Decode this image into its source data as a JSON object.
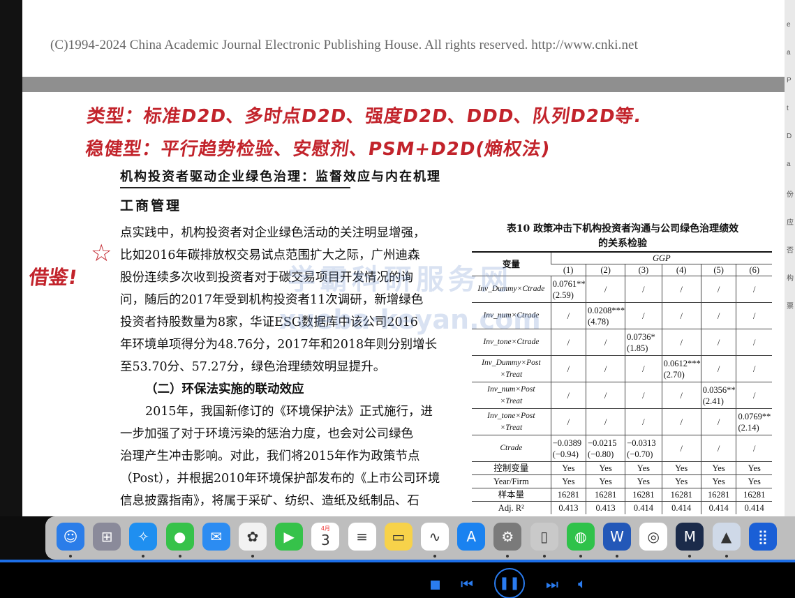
{
  "top_page": {
    "copyright": "(C)1994-2024 China Academic Journal Electronic Publishing House. All rights reserved.      http://www.cnki.net"
  },
  "handwriting": {
    "line1": "类型：标准D2D、多时点D2D、强度D2D、DDD、队列D2D等.",
    "line2": "稳健型：平行趋势检验、安慰剂、PSM+D2D(熵权法)",
    "note": "借鉴!",
    "star": "☆"
  },
  "paper": {
    "title": "机构投资者驱动企业绿色治理：监督效应与内在机理",
    "section": "工商管理",
    "lines": [
      "点实践中，机构投资者对企业绿色活动的关注明显增强，",
      "比如2016年碳排放权交易试点范围扩大之际，广州迪森",
      "股份连续多次收到投资者对于碳交易项目开发情况的询",
      "问，随后的2017年受到机构投资者11次调研，新增绿色",
      "投资者持股数量为8家，华证ESG数据库中该公司2016",
      "年环境单项得分为48.76分，2017年和2018年则分别增长",
      "至53.70分、57.27分，绿色治理绩效明显提升。"
    ],
    "subheading": "（二）环保法实施的联动效应",
    "lines2": [
      "2015年，我国新修订的《环境保护法》正式施行，进",
      "一步加强了对于环境污染的惩治力度，也会对公司绿色",
      "治理产生冲击影响。对此，我们将2015年作为政策节点",
      "（Post），并根据2010年环境保护部发布的《上市公司环境",
      "信息披露指南》，将属于采矿、纺织、造纸及纸制品、石"
    ]
  },
  "table": {
    "title_line1": "表10  政策冲击下机构投资者沟通与公司绿色治理绩效",
    "title_line2": "的关系检验",
    "var_header": "变量",
    "dep_header": "GGP",
    "cols": [
      "(1)",
      "(2)",
      "(3)",
      "(4)",
      "(5)",
      "(6)"
    ],
    "rows": [
      {
        "var": "Inv_Dummy×Ctrade",
        "vals": [
          [
            "0.0761**",
            "(2.59)"
          ],
          "/",
          "/",
          "/",
          "/",
          "/"
        ]
      },
      {
        "var": "Inv_num×Ctrade",
        "vals": [
          "/",
          [
            "0.0208***",
            "(4.78)"
          ],
          "/",
          "/",
          "/",
          "/"
        ]
      },
      {
        "var": "Inv_tone×Ctrade",
        "vals": [
          "/",
          "/",
          [
            "0.0736*",
            "(1.85)"
          ],
          "/",
          "/",
          "/"
        ]
      },
      {
        "var": "Inv_Dummy×Post ×Treat",
        "vals": [
          "/",
          "/",
          "/",
          [
            "0.0612***",
            "(2.70)"
          ],
          "/",
          "/"
        ]
      },
      {
        "var": "Inv_num×Post ×Treat",
        "vals": [
          "/",
          "/",
          "/",
          "/",
          [
            "0.0356**",
            "(2.41)"
          ],
          "/"
        ]
      },
      {
        "var": "Inv_tone×Post ×Treat",
        "vals": [
          "/",
          "/",
          "/",
          "/",
          "/",
          [
            "0.0769**",
            "(2.14)"
          ]
        ]
      },
      {
        "var": "Ctrade",
        "vals": [
          [
            "−0.0389",
            "(−0.94)"
          ],
          [
            "−0.0215",
            "(−0.80)"
          ],
          [
            "−0.0313",
            "(−0.70)"
          ],
          "/",
          "/",
          "/"
        ]
      }
    ],
    "control_label": "控制变量",
    "control_vals": [
      "Yes",
      "Yes",
      "Yes",
      "Yes",
      "Yes",
      "Yes"
    ],
    "fe_label": "Year/Firm",
    "fe_vals": [
      "Yes",
      "Yes",
      "Yes",
      "Yes",
      "Yes",
      "Yes"
    ],
    "n_label": "样本量",
    "n_vals": [
      "16281",
      "16281",
      "16281",
      "16281",
      "16281",
      "16281"
    ],
    "r2_label": "Adj. R²",
    "r2_vals": [
      "0.413",
      "0.413",
      "0.414",
      "0.414",
      "0.414",
      "0.414"
    ]
  },
  "watermark": {
    "line1": "学霸科研服务网",
    "line2": "xueba·keyan.com"
  },
  "dock": {
    "apps": [
      {
        "name": "finder-icon",
        "glyph": "☺",
        "color": "#2b7de9"
      },
      {
        "name": "launchpad-icon",
        "glyph": "⊞",
        "color": "#8a8a9a"
      },
      {
        "name": "safari-icon",
        "glyph": "✧",
        "color": "#1f8ff0"
      },
      {
        "name": "messages-icon",
        "glyph": "●",
        "color": "#36c24a"
      },
      {
        "name": "mail-icon",
        "glyph": "✉",
        "color": "#2c8cf2"
      },
      {
        "name": "photos-icon",
        "glyph": "✿",
        "color": "#f2f2f2"
      },
      {
        "name": "facetime-icon",
        "glyph": "▶",
        "color": "#36c24a"
      },
      {
        "name": "calendar-icon",
        "glyph": "3",
        "color": "#ffffff"
      },
      {
        "name": "reminders-icon",
        "glyph": "≡",
        "color": "#ffffff"
      },
      {
        "name": "notes-icon",
        "glyph": "▭",
        "color": "#f7d24a"
      },
      {
        "name": "freeform-icon",
        "glyph": "∿",
        "color": "#ffffff"
      },
      {
        "name": "app-store-icon",
        "glyph": "A",
        "color": "#1a82f0"
      },
      {
        "name": "system-settings-icon",
        "glyph": "⚙",
        "color": "#7a7a7a"
      },
      {
        "name": "iphone-mirroring-icon",
        "glyph": "▯",
        "color": "#c9c9c9"
      },
      {
        "name": "wechat-icon",
        "glyph": "◍",
        "color": "#2fc24a"
      },
      {
        "name": "word-icon",
        "glyph": "W",
        "color": "#2358b8"
      },
      {
        "name": "baidu-netdisk-icon",
        "glyph": "◎",
        "color": "#ffffff"
      },
      {
        "name": "mindmap-icon",
        "glyph": "M",
        "color": "#1b2b4a"
      },
      {
        "name": "preview-icon",
        "glyph": "▲",
        "color": "#cfd9e8"
      },
      {
        "name": "grid-app-icon",
        "glyph": "⣿",
        "color": "#1a5fd6"
      }
    ],
    "calendar_month": "4月",
    "calendar_day": "3"
  },
  "player": {
    "progress": 1.0
  }
}
